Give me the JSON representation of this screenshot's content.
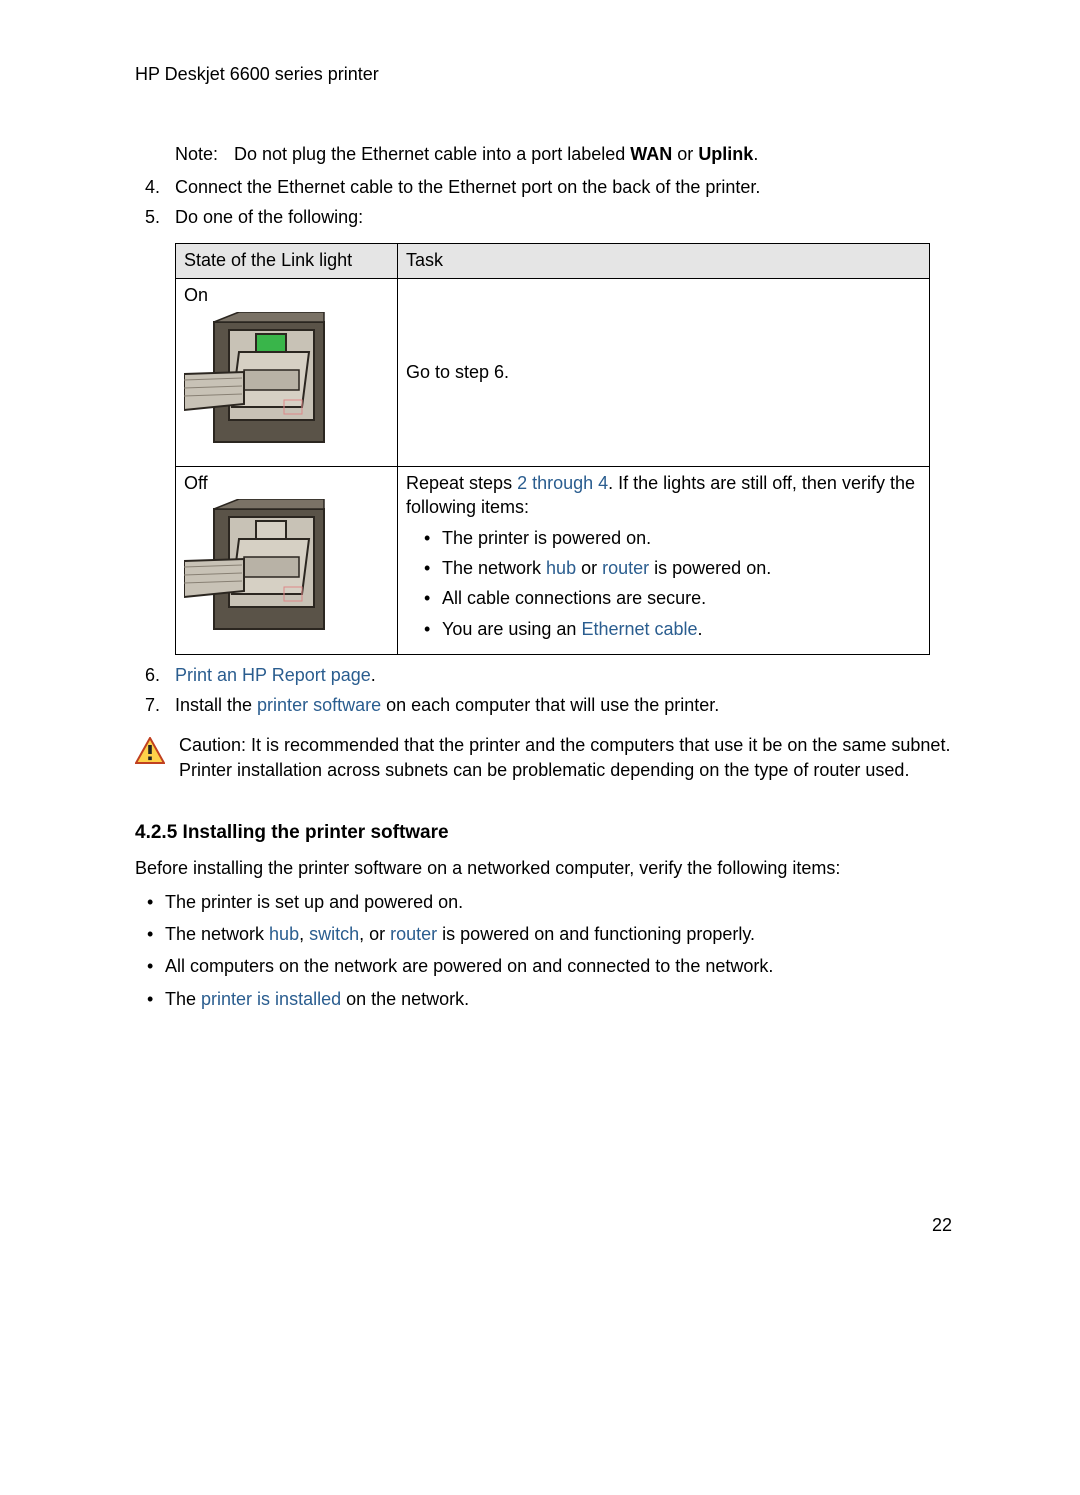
{
  "doc_title": "HP Deskjet 6600 series printer",
  "note_label": "Note:",
  "note_body_a": "Do not plug the Ethernet cable into a port labeled ",
  "note_body_b": " or ",
  "note_wan": "WAN",
  "note_uplink": "Uplink",
  "note_period": ".",
  "steps": {
    "s4_num": "4.",
    "s4_text": "Connect the Ethernet cable to the Ethernet port on the back of the printer.",
    "s5_num": "5.",
    "s5_text": "Do one of the following:",
    "s6_num": "6.",
    "s6_link": "Print an HP Report page",
    "s6_period": ".",
    "s7_num": "7.",
    "s7_a": "Install the ",
    "s7_link": "printer software",
    "s7_b": " on each computer that will use the printer."
  },
  "table": {
    "h1": "State of the Link light",
    "h2": "Task",
    "r1_state": "On",
    "r1_task": "Go to step 6.",
    "r2_state": "Off",
    "r2_task_a": "Repeat steps ",
    "r2_task_link": "2 through 4",
    "r2_task_b": ". If the lights are still off, then verify the following items:",
    "r2_items": {
      "i1": "The printer is powered on.",
      "i2a": "The network ",
      "i2link1": "hub",
      "i2b": " or ",
      "i2link2": "router",
      "i2c": " is powered on.",
      "i3": "All cable connections are secure.",
      "i4a": "You are using an ",
      "i4link": "Ethernet cable",
      "i4b": "."
    }
  },
  "caution_label": "Caution: ",
  "caution_text": "It is recommended that the printer and the computers that use it be on the same subnet. Printer installation across subnets can be problematic depending on the type of router used.",
  "section_heading": "4.2.5  Installing the printer software",
  "section_intro": "Before installing the printer software on a networked computer, verify the following items:",
  "bullets": {
    "b1": "The printer is set up and powered on.",
    "b2a": "The network ",
    "b2link1": "hub",
    "b2b": ", ",
    "b2link2": "switch",
    "b2c": ", or ",
    "b2link3": "router",
    "b2d": " is powered on and functioning properly.",
    "b3": "All computers on the network are powered on and connected to the network.",
    "b4a": "The ",
    "b4link": "printer is installed",
    "b4b": " on the network."
  },
  "page_number": "22"
}
